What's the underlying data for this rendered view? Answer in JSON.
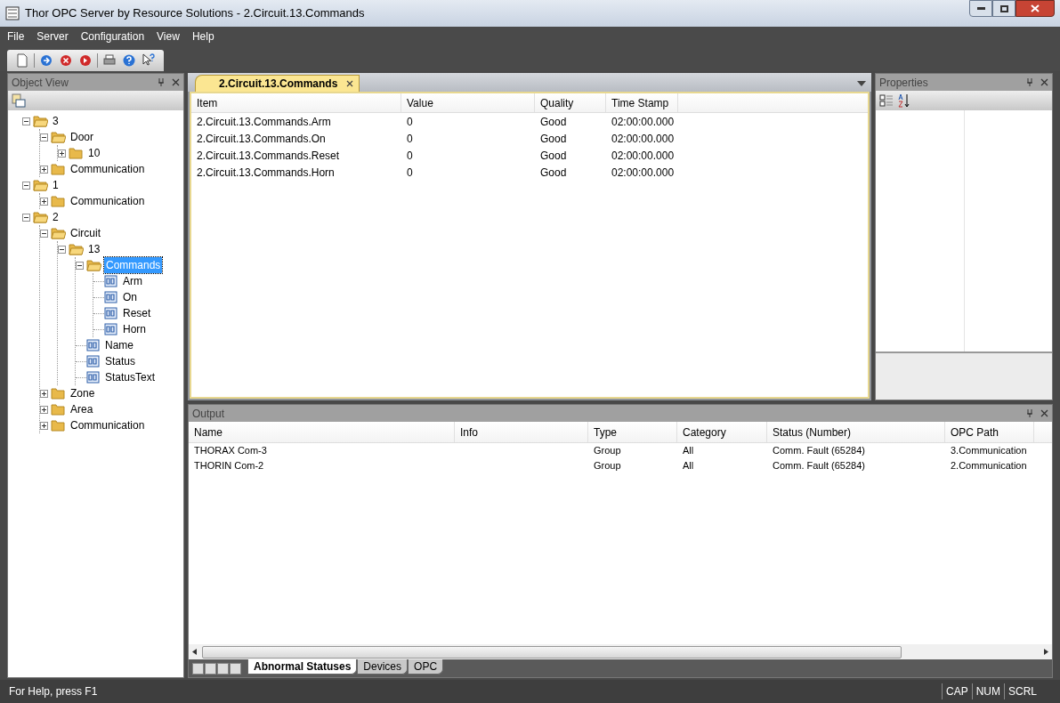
{
  "window": {
    "title": "Thor OPC Server by Resource Solutions - 2.Circuit.13.Commands"
  },
  "menu": [
    "File",
    "Server",
    "Configuration",
    "View",
    "Help"
  ],
  "object_view": {
    "title": "Object View",
    "tree": [
      {
        "label": "3",
        "kind": "folder",
        "expanded": true,
        "selected": false,
        "children": [
          {
            "label": "Door",
            "kind": "folder",
            "expanded": true,
            "selected": false,
            "children": [
              {
                "label": "10",
                "kind": "folder",
                "expanded": false,
                "selected": false
              }
            ]
          },
          {
            "label": "Communication",
            "kind": "folder",
            "expanded": false,
            "selected": false
          }
        ]
      },
      {
        "label": "1",
        "kind": "folder",
        "expanded": true,
        "selected": false,
        "children": [
          {
            "label": "Communication",
            "kind": "folder",
            "expanded": false,
            "selected": false
          }
        ]
      },
      {
        "label": "2",
        "kind": "folder",
        "expanded": true,
        "selected": false,
        "children": [
          {
            "label": "Circuit",
            "kind": "folder",
            "expanded": true,
            "selected": false,
            "children": [
              {
                "label": "13",
                "kind": "folder",
                "expanded": true,
                "selected": false,
                "children": [
                  {
                    "label": "Commands",
                    "kind": "folder",
                    "expanded": true,
                    "selected": true,
                    "children": [
                      {
                        "label": "Arm",
                        "kind": "tag",
                        "selected": false
                      },
                      {
                        "label": "On",
                        "kind": "tag",
                        "selected": false
                      },
                      {
                        "label": "Reset",
                        "kind": "tag",
                        "selected": false
                      },
                      {
                        "label": "Horn",
                        "kind": "tag",
                        "selected": false
                      }
                    ]
                  },
                  {
                    "label": "Name",
                    "kind": "tag",
                    "selected": false
                  },
                  {
                    "label": "Status",
                    "kind": "tag",
                    "selected": false
                  },
                  {
                    "label": "StatusText",
                    "kind": "tag",
                    "selected": false
                  }
                ]
              }
            ]
          },
          {
            "label": "Zone",
            "kind": "folder",
            "expanded": false,
            "selected": false
          },
          {
            "label": "Area",
            "kind": "folder",
            "expanded": false,
            "selected": false
          },
          {
            "label": "Communication",
            "kind": "folder",
            "expanded": false,
            "selected": false
          }
        ]
      }
    ]
  },
  "document_tabs": [
    {
      "label": "2.Circuit.13.Commands",
      "selected": true
    }
  ],
  "items_table": {
    "columns": [
      "Item",
      "Value",
      "Quality",
      "Time Stamp"
    ],
    "rows": [
      [
        "2.Circuit.13.Commands.Arm",
        "0",
        "Good",
        "02:00:00.000"
      ],
      [
        "2.Circuit.13.Commands.On",
        "0",
        "Good",
        "02:00:00.000"
      ],
      [
        "2.Circuit.13.Commands.Reset",
        "0",
        "Good",
        "02:00:00.000"
      ],
      [
        "2.Circuit.13.Commands.Horn",
        "0",
        "Good",
        "02:00:00.000"
      ]
    ]
  },
  "properties": {
    "title": "Properties"
  },
  "output": {
    "title": "Output",
    "columns": [
      "Name",
      "Info",
      "Type",
      "Category",
      "Status (Number)",
      "OPC Path"
    ],
    "rows": [
      [
        "THORAX Com-3",
        "",
        "Group",
        "All",
        "Comm. Fault (65284)",
        "3.Communication"
      ],
      [
        "THORIN Com-2",
        "",
        "Group",
        "All",
        "Comm. Fault (65284)",
        "2.Communication"
      ]
    ],
    "tabs": [
      {
        "label": "Abnormal Statuses",
        "selected": true
      },
      {
        "label": "Devices",
        "selected": false
      },
      {
        "label": "OPC",
        "selected": false
      }
    ]
  },
  "status_bar": {
    "text": "For Help, press F1",
    "indicators": [
      "CAP",
      "NUM",
      "SCRL"
    ]
  }
}
